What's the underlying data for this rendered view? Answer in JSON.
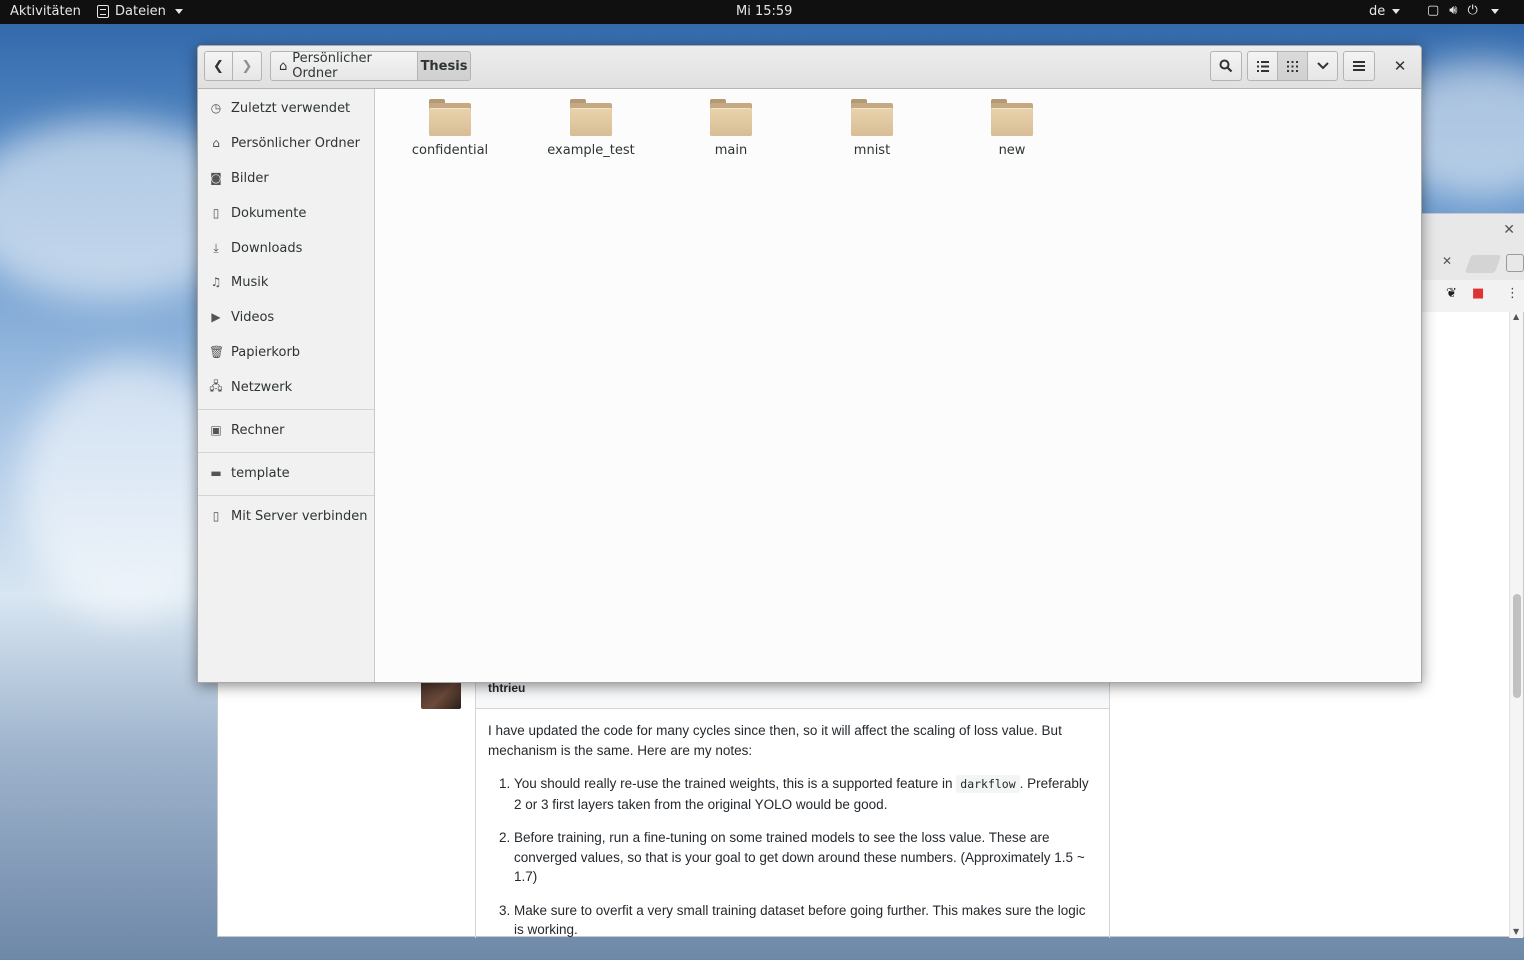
{
  "topbar": {
    "activities": "Aktivitäten",
    "app_name": "Dateien",
    "clock": "Mi 15:59",
    "language": "de"
  },
  "files_window": {
    "breadcrumb": {
      "home_label": "Persönlicher Ordner",
      "current_label": "Thesis"
    },
    "sidebar": {
      "items": [
        {
          "label": "Zuletzt verwendet",
          "icon": "clock-icon"
        },
        {
          "label": "Persönlicher Ordner",
          "icon": "home-icon"
        },
        {
          "label": "Bilder",
          "icon": "camera-icon"
        },
        {
          "label": "Dokumente",
          "icon": "document-icon"
        },
        {
          "label": "Downloads",
          "icon": "download-icon"
        },
        {
          "label": "Musik",
          "icon": "music-icon"
        },
        {
          "label": "Videos",
          "icon": "video-icon"
        },
        {
          "label": "Papierkorb",
          "icon": "trash-icon"
        },
        {
          "label": "Netzwerk",
          "icon": "network-icon"
        }
      ],
      "devices": [
        {
          "label": "Rechner",
          "icon": "computer-icon"
        }
      ],
      "bookmarks": [
        {
          "label": "template",
          "icon": "folder-icon"
        }
      ],
      "connect": {
        "label": "Mit Server verbinden",
        "icon": "server-icon"
      }
    },
    "folders": [
      "confidential",
      "example_test",
      "main",
      "mnist",
      "new"
    ]
  },
  "browser": {
    "comment_author": "thtrieu",
    "comment_paragraph": "I have updated the code for many cycles since then, so it will affect the scaling of loss value. But mechanism is the same. Here are my notes:",
    "notes": [
      {
        "before": "You should really re-use the trained weights, this is a supported feature in ",
        "code": "darkflow",
        "after": ". Preferably 2 or 3 first layers taken from the original YOLO would be good."
      },
      {
        "before": "Before training, run a fine-tuning on some trained models to see the loss value. These are converged values, so that is your goal to get down around these numbers. (Approximately 1.5 ~ 1.7)",
        "code": "",
        "after": ""
      },
      {
        "before": "Make sure to overfit a very small training dataset before going further. This makes sure the logic is working.",
        "code": "",
        "after": ""
      }
    ]
  },
  "colors": {
    "topbar_bg": "#101010",
    "folder": "#d8bd94",
    "sidebar_bg": "#f1f1f1"
  }
}
